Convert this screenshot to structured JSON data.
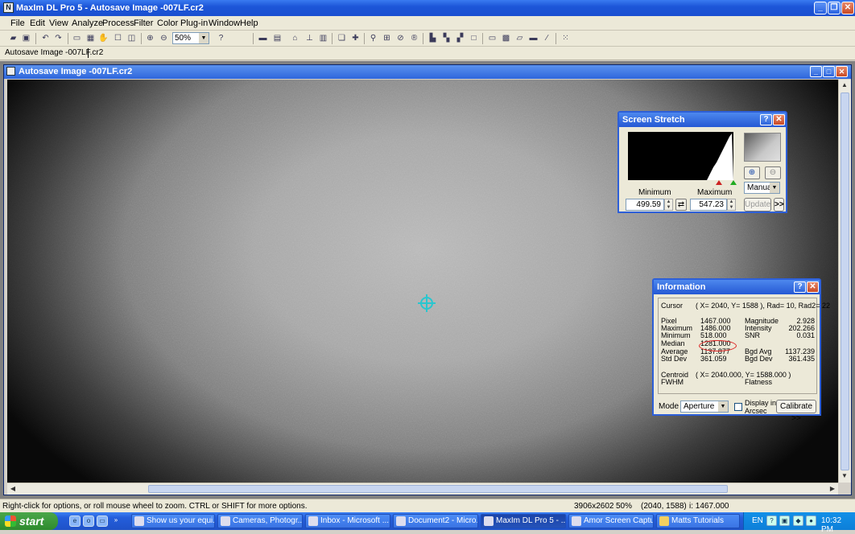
{
  "app": {
    "title": "MaxIm DL Pro 5 - Autosave Image -007LF.cr2",
    "icon_letter": "N"
  },
  "menu": [
    "File",
    "Edit",
    "View",
    "Analyze",
    "Process",
    "Filter",
    "Color",
    "Plug-in",
    "Window",
    "Help"
  ],
  "toolbar": {
    "zoom_value": "50%"
  },
  "doc_tab": {
    "label": "Autosave Image -007LF.cr2"
  },
  "image_window": {
    "title": "Autosave Image -007LF.cr2"
  },
  "screen_stretch": {
    "title": "Screen Stretch",
    "minimum_label": "Minimum",
    "maximum_label": "Maximum",
    "minimum_value": "499.59",
    "maximum_value": "547.23",
    "mode_value": "Manual",
    "update_label": "Update",
    "more_label": ">>"
  },
  "information": {
    "title": "Information",
    "cursor_label": "Cursor",
    "cursor_value": "( X= 2040, Y= 1588 ), Rad= 10, Rad2= 22",
    "pixel_label": "Pixel",
    "pixel_value": "1467.000",
    "maximum_label": "Maximum",
    "maximum_value": "1486.000",
    "minimum_label": "Minimum",
    "minimum_value": "518.000",
    "median_label": "Median",
    "median_value": "1281.000",
    "average_label": "Average",
    "average_value": "1137.877",
    "stddev_label": "Std Dev",
    "stddev_value": "361.059",
    "magnitude_label": "Magnitude",
    "magnitude_value": "2.928",
    "intensity_label": "Intensity",
    "intensity_value": "202.266",
    "snr_label": "SNR",
    "snr_value": "0.031",
    "bgd_avg_label": "Bgd Avg",
    "bgd_avg_value": "1137.239",
    "bgd_dev_label": "Bgd Dev",
    "bgd_dev_value": "361.435",
    "centroid_label": "Centroid",
    "centroid_value": "( X= 2040.000, Y= 1588.000 )",
    "fwhm_label": "FWHM",
    "flatness_label": "Flatness",
    "mode_label": "Mode",
    "mode_value": "Aperture",
    "display_arcsec_label_1": "Display in",
    "display_arcsec_label_2": "Arcsec",
    "calibrate_label": "Calibrate >>"
  },
  "status": {
    "hint": "Right-click for options, or roll mouse wheel to zoom. CTRL or SHIFT for more options.",
    "dimensions": "3906x2602",
    "zoom": "50%",
    "coords": "(2040, 1588)",
    "intensity": "i: 1467.000"
  },
  "taskbar": {
    "start_label": "start",
    "tasks": [
      "Show us your equi...",
      "Cameras, Photogr...",
      "Inbox - Microsoft ...",
      "Document2 - Micro...",
      "MaxIm DL Pro 5 - ...",
      "Amor Screen Capture",
      "Matts Tutorials"
    ],
    "lang": "EN",
    "clock": "10:32 PM"
  },
  "colors": {
    "title_blue": "#2558d4",
    "cursor_marker": "#29c6cf",
    "annotation_red": "#d22222",
    "taskbar_blue": "#245edb",
    "start_green": "#3a9a3a"
  }
}
